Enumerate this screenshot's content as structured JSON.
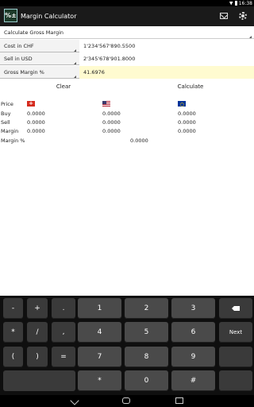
{
  "status_bar": {
    "time": "16:38"
  },
  "app": {
    "title": "Margin Calculator",
    "icon_text": "%±"
  },
  "mode": {
    "selected": "Calculate Gross Margin"
  },
  "inputs": [
    {
      "label": "Cost in CHF",
      "value": "1'234'567'890.5500",
      "highlight": false
    },
    {
      "label": "Sell in USD",
      "value": "2'345'678'901.8000",
      "highlight": false
    },
    {
      "label": "Gross Margin %",
      "value": "41.6976",
      "highlight": true
    }
  ],
  "actions": {
    "clear": "Clear",
    "calculate": "Calculate"
  },
  "results": {
    "price_label": "Price",
    "currencies": [
      "CHF",
      "USD",
      "EUR"
    ],
    "rows": [
      {
        "label": "Buy",
        "values": [
          "0.0000",
          "0.0000",
          "0.0000"
        ]
      },
      {
        "label": "Sell",
        "values": [
          "0.0000",
          "0.0000",
          "0.0000"
        ]
      },
      {
        "label": "Margin",
        "values": [
          "0.0000",
          "0.0000",
          "0.0000"
        ]
      }
    ],
    "margin_pct_label": "Margin %",
    "margin_pct_value": "0.0000"
  },
  "keypad": {
    "row1": [
      "-",
      "+",
      ".",
      "1",
      "2",
      "3",
      "backspace"
    ],
    "row2": [
      "*",
      "/",
      ",",
      "4",
      "5",
      "6",
      "Next"
    ],
    "row3": [
      "(",
      ")",
      "=",
      "7",
      "8",
      "9",
      ""
    ],
    "row4": [
      "",
      "*",
      "0",
      "#",
      ""
    ]
  },
  "icons": {
    "mail": "mail-icon",
    "settings": "gear-icon",
    "back": "back-icon",
    "home": "home-icon",
    "recents": "recents-icon"
  },
  "colors": {
    "action_bar": "#1a1a1a",
    "highlight_field": "#fffbd0",
    "keypad_bg": "#0f0f0f"
  }
}
